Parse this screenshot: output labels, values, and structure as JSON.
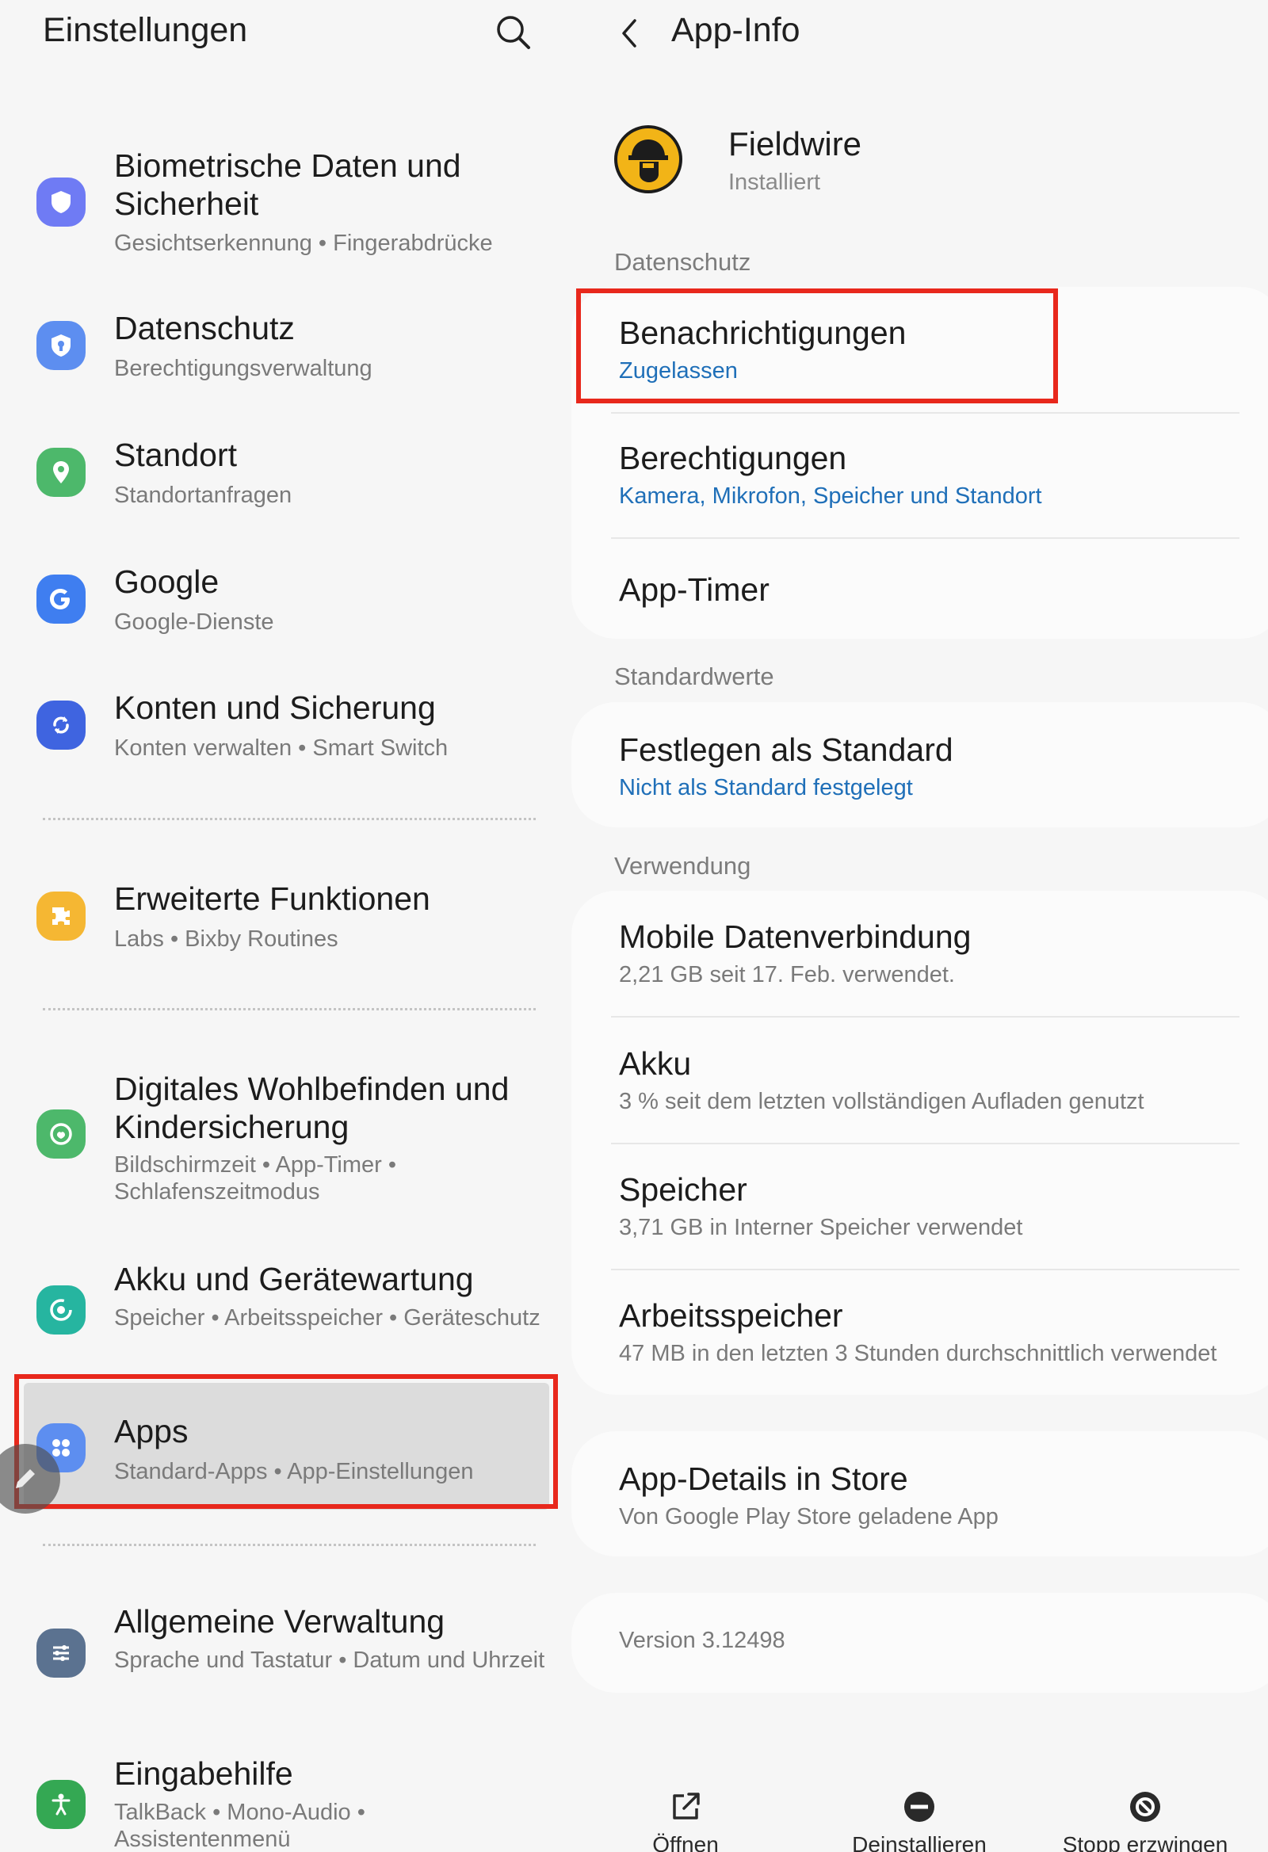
{
  "left": {
    "title": "Einstellungen",
    "items": [
      {
        "title": "Biometrische Daten und Sicherheit",
        "subtitle": "Gesichtserkennung • Fingerabdrücke",
        "icon": "shield-icon",
        "color": "#6f7bf4"
      },
      {
        "title": "Datenschutz",
        "subtitle": "Berechtigungsverwaltung",
        "icon": "privacy-icon",
        "color": "#5d8ef0"
      },
      {
        "title": "Standort",
        "subtitle": "Standortanfragen",
        "icon": "location-pin-icon",
        "color": "#4db86b"
      },
      {
        "title": "Google",
        "subtitle": "Google-Dienste",
        "icon": "google-icon",
        "color": "#3f7ef0"
      },
      {
        "title": "Konten und Sicherung",
        "subtitle": "Konten verwalten • Smart Switch",
        "icon": "sync-icon",
        "color": "#3f64e0"
      },
      {
        "title": "Erweiterte Funktionen",
        "subtitle": "Labs • Bixby Routines",
        "icon": "puzzle-icon",
        "color": "#f5b733"
      },
      {
        "title": "Digitales Wohlbefinden und Kindersicherung",
        "subtitle": "Bildschirmzeit • App-Timer • Schlafenszeitmodus",
        "icon": "wellbeing-icon",
        "color": "#4db86b"
      },
      {
        "title": "Akku und Gerätewartung",
        "subtitle": "Speicher • Arbeitsspeicher • Geräteschutz",
        "icon": "device-care-icon",
        "color": "#26b5a0"
      },
      {
        "title": "Apps",
        "subtitle": "Standard-Apps • App-Einstellungen",
        "icon": "apps-grid-icon",
        "color": "#5d8ef0"
      },
      {
        "title": "Allgemeine Verwaltung",
        "subtitle": "Sprache und Tastatur • Datum und Uhrzeit",
        "icon": "sliders-icon",
        "color": "#5b7290"
      },
      {
        "title": "Eingabehilfe",
        "subtitle": "TalkBack • Mono-Audio • Assistentenmenü",
        "icon": "accessibility-icon",
        "color": "#34a853"
      }
    ]
  },
  "right": {
    "title": "App-Info",
    "app_name": "Fieldwire",
    "app_status": "Installiert",
    "sections": {
      "privacy": "Datenschutz",
      "defaults": "Standardwerte",
      "usage": "Verwendung"
    },
    "notifications": {
      "title": "Benachrichtigungen",
      "value": "Zugelassen"
    },
    "permissions": {
      "title": "Berechtigungen",
      "value": "Kamera, Mikrofon, Speicher und Standort"
    },
    "app_timer": {
      "title": "App-Timer"
    },
    "set_default": {
      "title": "Festlegen als Standard",
      "value": "Nicht als Standard festgelegt"
    },
    "mobile_data": {
      "title": "Mobile Datenverbindung",
      "value": "2,21 GB seit 17. Feb. verwendet."
    },
    "battery": {
      "title": "Akku",
      "value": "3 % seit dem letzten vollständigen Aufladen genutzt"
    },
    "storage": {
      "title": "Speicher",
      "value": "3,71 GB in Interner Speicher verwendet"
    },
    "memory": {
      "title": "Arbeitsspeicher",
      "value": "47 MB in den letzten 3 Stunden durchschnittlich verwendet"
    },
    "store": {
      "title": "App-Details in Store",
      "value": "Von Google Play Store geladene App"
    },
    "version": "Version 3.12498",
    "bottom": {
      "open": "Öffnen",
      "uninstall": "Deinstallieren",
      "force_stop": "Stopp erzwingen"
    }
  },
  "colors": {
    "highlight": "#e8281c",
    "link_blue": "#1f6fb8"
  }
}
